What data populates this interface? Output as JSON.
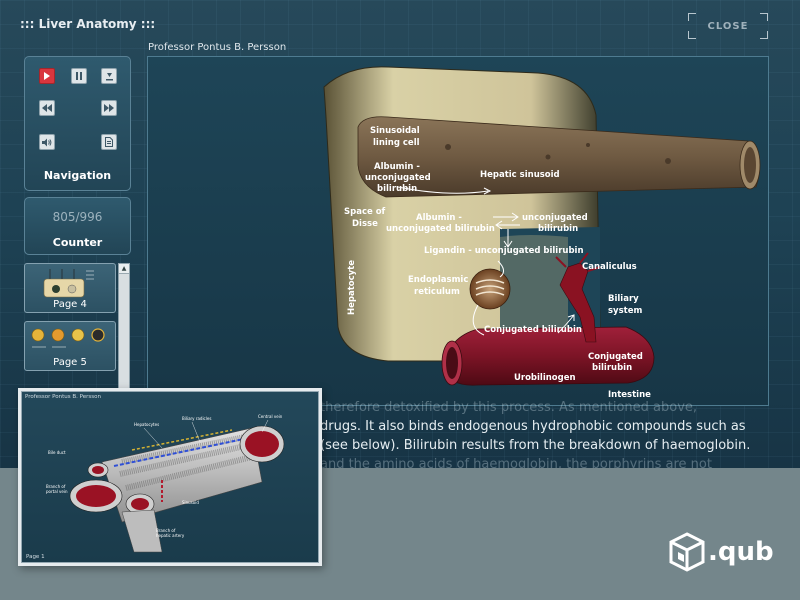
{
  "window": {
    "title": "::: Liver Anatomy :::",
    "close_label": "CLOSE"
  },
  "author": "Professor Pontus B. Persson",
  "navigation": {
    "label": "Navigation",
    "buttons": [
      {
        "name": "play-button",
        "icon": "play-icon",
        "color": "#d9363e"
      },
      {
        "name": "pause-button",
        "icon": "pause-icon"
      },
      {
        "name": "download-button",
        "icon": "download-icon"
      },
      {
        "name": "rewind-button",
        "icon": "rewind-icon"
      },
      {
        "name": "forward-button",
        "icon": "fast-forward-icon"
      },
      {
        "name": "audio-button",
        "icon": "speaker-icon"
      },
      {
        "name": "document-button",
        "icon": "document-icon"
      }
    ]
  },
  "counter": {
    "value": "805/996",
    "label": "Counter"
  },
  "pages": [
    {
      "label": "Page 4"
    },
    {
      "label": "Page 5"
    }
  ],
  "illustration": {
    "labels": {
      "sinusoidal_lining_cell": [
        "Sinusoidal",
        "lining cell"
      ],
      "albumin_unconjugated_top": [
        "Albumin -",
        "unconjugated",
        "bilirubin"
      ],
      "hepatic_sinusoid": "Hepatic sinusoid",
      "space_of_disse": [
        "Space of",
        "Disse"
      ],
      "albumin_unconjugated_mid": [
        "Albumin -",
        "unconjugated bilirubin"
      ],
      "unconjugated_bilirubin": [
        "unconjugated",
        "bilirubin"
      ],
      "ligandin": "Ligandin - unconjugated bilirubin",
      "hepatocyte": "Hepatocyte",
      "endoplasmic_reticulum": [
        "Endoplasmic",
        "reticulum"
      ],
      "canaliculus": "Canaliculus",
      "biliary_system": [
        "Biliary",
        "system"
      ],
      "conjugated_bilirubin": "Conjugated bilirubin",
      "conjugated_bilirubin_intestine": [
        "Conjugated",
        "bilirubin"
      ],
      "urobilinogen": "Urobilinogen",
      "intestine": "Intestine"
    }
  },
  "body_text": {
    "line1": "therefore detoxified by this process. As mentioned above,",
    "line2": "drugs. It also binds endogenous hydrophobic compounds such as",
    "line3": "(see below). Bilirubin results from the breakdown of haemoglobin.",
    "line4": "and the amino acids of haemoglobin, the porphyrins are not"
  },
  "preview": {
    "author": "Professor Pontus B. Persson",
    "page_label": "Page 1",
    "labels": {
      "hepatocytes": "Hepatocytes",
      "biliary_radicles": "Biliary radicles",
      "central_vein": "Central vein",
      "bile_duct": "Bile duct",
      "portal_vein": [
        "Branch of",
        "portal vein"
      ],
      "sinusoid": "Sinusoid",
      "hepatic_artery": [
        "Branch of",
        "hepatic artery"
      ]
    }
  },
  "logo": {
    "text": ".qub",
    "icon": "qub-cube-icon"
  }
}
